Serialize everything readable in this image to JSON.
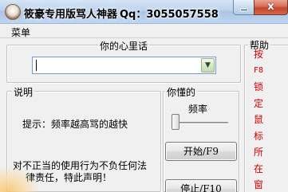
{
  "window": {
    "title": "筱豪专用版骂人神器",
    "qq": "Qq：3055057558",
    "close_glyph": "x"
  },
  "menu": {
    "items": [
      "菜单"
    ]
  },
  "heart_group": {
    "legend": "你的心里话",
    "combo_value": ""
  },
  "explain_group": {
    "legend": "说明",
    "hint": "提示：频率越高骂的越快",
    "notice_lines": [
      "对不正当的使用行为不负任何法",
      "律责任，特此声明！"
    ]
  },
  "understand_group": {
    "legend": "你懂的",
    "freq_label": "频率",
    "freq_value": 0,
    "start_button": "开始/F9",
    "stop_button": "停止/F10"
  },
  "help_group": {
    "legend": "帮助",
    "chars": [
      "按",
      "F8",
      "锁",
      "定",
      "鼠",
      "标",
      "所",
      "在",
      "窗"
    ]
  },
  "colors": {
    "help_text": "#d40000",
    "client_bg": "#f0f0f0"
  }
}
